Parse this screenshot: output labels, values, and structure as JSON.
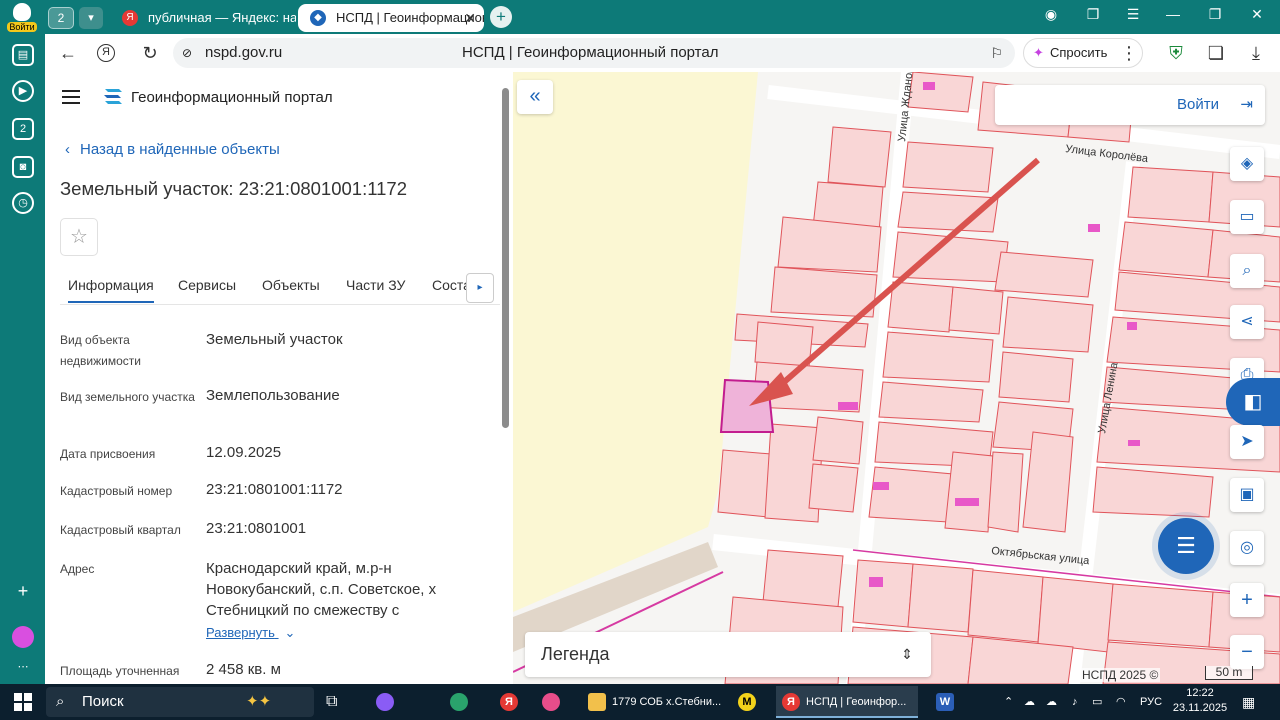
{
  "browser": {
    "yandex_login_label": "Войти",
    "tab_count": "2",
    "tabs": [
      {
        "title": "публичная — Яндекс: нашлось",
        "fav": "Я"
      },
      {
        "title": "НСПД | Геоинформационный портал",
        "fav": "◆"
      }
    ],
    "url_domain": "nspd.gov.ru",
    "page_title": "НСПД | Геоинформационный портал",
    "ask_label": "Спросить"
  },
  "panel": {
    "brand": "Геоинформационный портал",
    "back_link": "Назад в найденные объекты",
    "title": "Земельный участок: 23:21:0801001:1172",
    "tabs": [
      "Информация",
      "Сервисы",
      "Объекты",
      "Части ЗУ",
      "Соста..."
    ],
    "fields": [
      {
        "label": "Вид объекта недвижимости",
        "value": "Земельный участок"
      },
      {
        "label": "Вид земельного участка",
        "value": "Землепользование"
      },
      {
        "label": "Дата присвоения",
        "value": "12.09.2025"
      },
      {
        "label": "Кадастровый номер",
        "value": "23:21:0801001:1172"
      },
      {
        "label": "Кадастровый квартал",
        "value": "23:21:0801001"
      },
      {
        "label": "Адрес",
        "value": "Краснодарский край, м.р-н Новокубанский, с.п. Советское, х Стебницкий по смежеству с"
      },
      {
        "label": "Площадь уточненная",
        "value": "2 458 кв. м"
      }
    ],
    "expand_label": "Развернуть"
  },
  "map": {
    "login_label": "Войти",
    "legend_label": "Легенда",
    "copyright": "НСПД 2025 ©",
    "scale": "50 m",
    "streets": [
      "Улица Жданова",
      "Улица Королёва",
      "Улица Ленина",
      "Октябрьская улица"
    ],
    "colors": {
      "parcel_fill": "#f9d6d6",
      "parcel_stroke": "#e0545a",
      "selected": "#c21d8f",
      "arrow": "#d9534f",
      "field": "#fbf7d3"
    }
  },
  "taskbar": {
    "search_label": "Поиск",
    "apps": [
      "1779 СОБ х.Стебни...",
      "НСПД | Геоинфор..."
    ],
    "lang": "РУС",
    "time": "12:22",
    "date": "23.11.2025"
  }
}
